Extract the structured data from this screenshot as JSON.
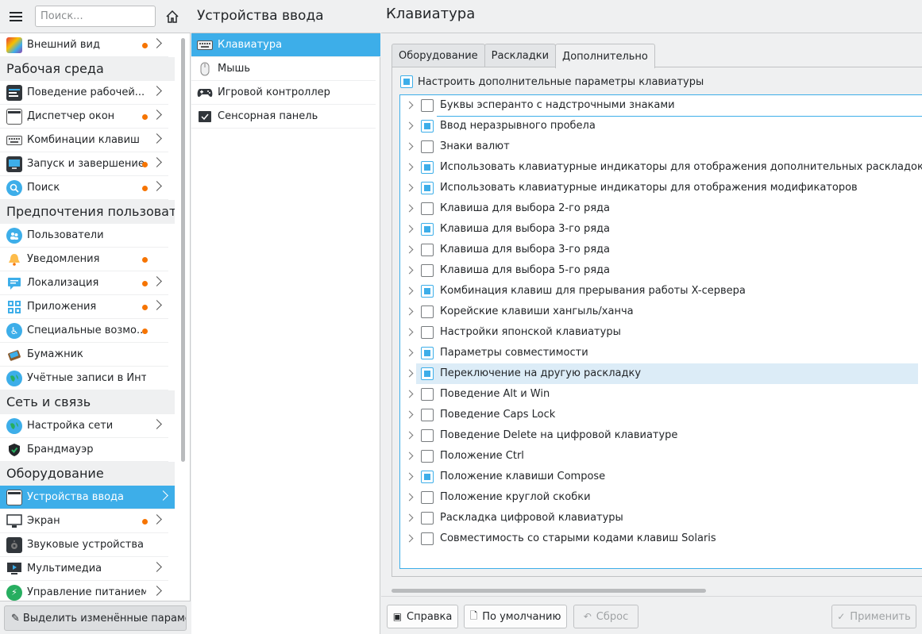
{
  "sidebar": {
    "search_placeholder": "Поиск...",
    "items": [
      {
        "label": "Внешний вид"
      },
      {
        "label": "Рабочая среда"
      },
      {
        "label": "Поведение рабочей..."
      },
      {
        "label": "Диспетчер окон"
      },
      {
        "label": "Комбинации клавиш"
      },
      {
        "label": "Запуск и завершение"
      },
      {
        "label": "Поиск"
      },
      {
        "label": "Предпочтения пользователя"
      },
      {
        "label": "Пользователи"
      },
      {
        "label": "Уведомления"
      },
      {
        "label": "Локализация"
      },
      {
        "label": "Приложения"
      },
      {
        "label": "Специальные возмо..."
      },
      {
        "label": "Бумажник"
      },
      {
        "label": "Учётные записи в Интер..."
      },
      {
        "label": "Сеть и связь"
      },
      {
        "label": "Настройка сети"
      },
      {
        "label": "Брандмауэр"
      },
      {
        "label": "Оборудование"
      },
      {
        "label": "Устройства ввода"
      },
      {
        "label": "Экран"
      },
      {
        "label": "Звуковые устройства"
      },
      {
        "label": "Мультимедиа"
      },
      {
        "label": "Управление питанием"
      }
    ],
    "footer_button": "Выделить изменённые параметры"
  },
  "middle": {
    "title": "Устройства ввода",
    "items": [
      {
        "label": "Клавиатура"
      },
      {
        "label": "Мышь"
      },
      {
        "label": "Игровой контроллер"
      },
      {
        "label": "Сенсорная панель"
      }
    ]
  },
  "main": {
    "title": "Клавиатура",
    "tabs": [
      {
        "label": "Оборудование"
      },
      {
        "label": "Раскладки"
      },
      {
        "label": "Дополнительно"
      }
    ],
    "configure_label": "Настроить дополнительные параметры клавиатуры",
    "options": [
      {
        "label": "Буквы эсперанто с надстрочными знаками",
        "checked": false
      },
      {
        "label": "Ввод неразрывного пробела",
        "checked": true
      },
      {
        "label": "Знаки валют",
        "checked": false
      },
      {
        "label": "Использовать клавиатурные индикаторы для отображения дополнительных раскладок",
        "checked": true
      },
      {
        "label": "Использовать клавиатурные индикаторы для отображения модификаторов",
        "checked": true
      },
      {
        "label": "Клавиша для выбора 2-го ряда",
        "checked": false
      },
      {
        "label": "Клавиша для выбора 3-го ряда",
        "checked": true
      },
      {
        "label": "Клавиша для выбора 3-го ряда",
        "checked": false
      },
      {
        "label": "Клавиша для выбора 5-го ряда",
        "checked": false
      },
      {
        "label": "Комбинация клавиш для прерывания работы X-сервера",
        "checked": true
      },
      {
        "label": "Корейские клавиши хангыль/ханча",
        "checked": false
      },
      {
        "label": "Настройки японской клавиатуры",
        "checked": false
      },
      {
        "label": "Параметры совместимости",
        "checked": true
      },
      {
        "label": "Переключение на другую раскладку",
        "checked": true
      },
      {
        "label": "Поведение Alt и Win",
        "checked": false
      },
      {
        "label": "Поведение Caps Lock",
        "checked": false
      },
      {
        "label": "Поведение Delete на цифровой клавиатуре",
        "checked": false
      },
      {
        "label": "Положение Ctrl",
        "checked": false
      },
      {
        "label": "Положение клавиши Compose",
        "checked": true
      },
      {
        "label": "Положение круглой скобки",
        "checked": false
      },
      {
        "label": "Раскладка цифровой клавиатуры",
        "checked": false
      },
      {
        "label": "Совместимость со старыми кодами клавиш Solaris",
        "checked": false
      }
    ],
    "buttons": {
      "help": "Справка",
      "defaults": "По умолчанию",
      "reset": "Сброс",
      "apply": "Применить"
    }
  },
  "colors": {
    "accent": "#3daee9",
    "changed_dot": "#f67400"
  }
}
